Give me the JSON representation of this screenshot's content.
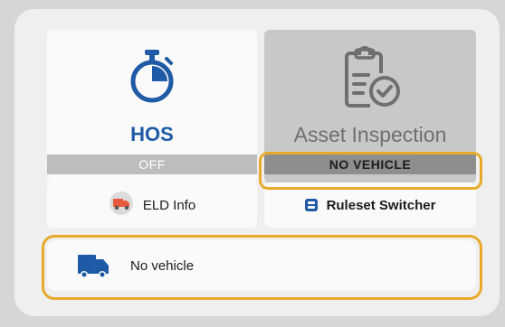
{
  "tiles": {
    "hos": {
      "title": "HOS",
      "status": "OFF",
      "icon": "stopwatch-icon"
    },
    "asset_inspection": {
      "title": "Asset Inspection",
      "status": "NO VEHICLE",
      "icon": "clipboard-check-icon"
    }
  },
  "actions": {
    "eld_info": {
      "label": "ELD Info",
      "icon": "truck-icon"
    },
    "ruleset_switcher": {
      "label": "Ruleset Switcher",
      "icon": "ruleset-icon"
    }
  },
  "vehicle": {
    "label": "No vehicle",
    "icon": "truck-icon"
  },
  "colors": {
    "accent": "#1f5aa6",
    "highlight": "#e7aa2b",
    "disabled_tile": "#c8c8c8"
  }
}
